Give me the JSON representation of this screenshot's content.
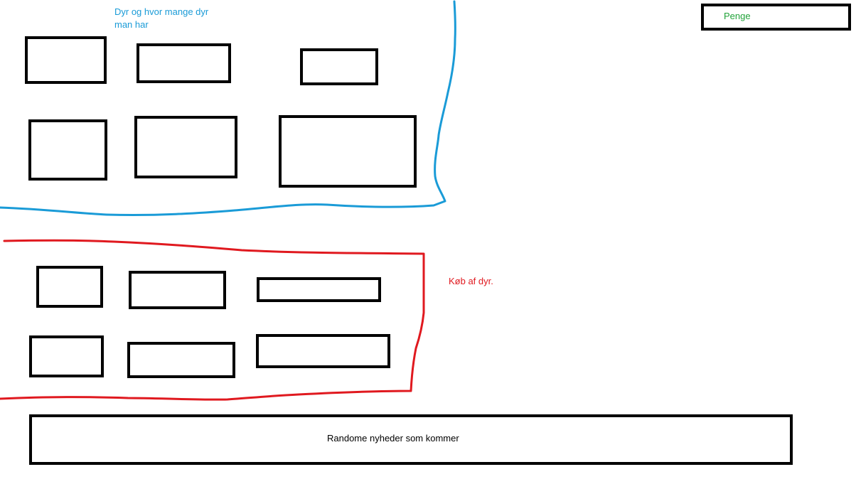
{
  "sections": {
    "animals": {
      "label_line1": "Dyr og hvor mange dyr",
      "label_line2": "man har",
      "outline_color": "#1a9bd7"
    },
    "purchase": {
      "label": "Køb af dyr.",
      "outline_color": "#e0191f"
    },
    "money": {
      "label": "Penge",
      "label_color": "#22a33a"
    },
    "news": {
      "label": "Randome nyheder som kommer"
    }
  }
}
